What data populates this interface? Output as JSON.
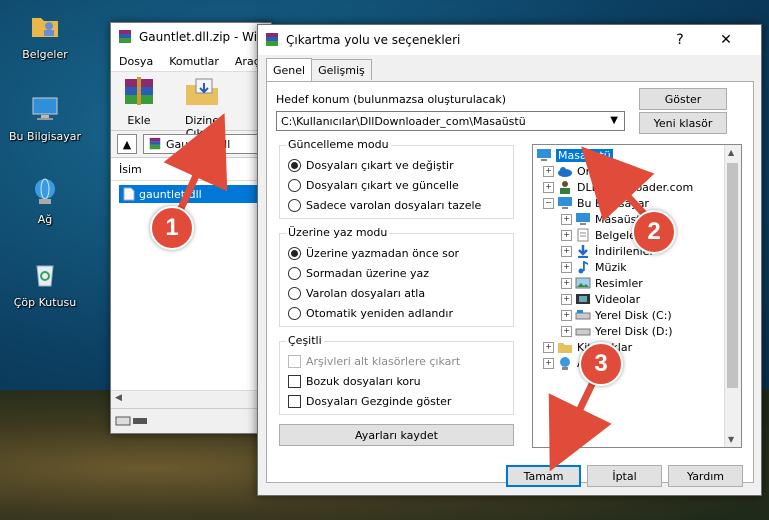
{
  "desktop": {
    "icons": [
      {
        "label": "Belgeler"
      },
      {
        "label": "Bu Bilgisayar"
      },
      {
        "label": "Ağ"
      },
      {
        "label": "Çöp Kutusu"
      }
    ]
  },
  "winrar": {
    "title": "Gauntlet.dll.zip - Win",
    "menu": [
      "Dosya",
      "Komutlar",
      "Araçla"
    ],
    "toolbar": {
      "extract_label": "Ekle",
      "extract_to_label": "Dizine Çıkart"
    },
    "path": "Gauntlet.dll",
    "column_name": "İsim",
    "file_name": "gauntlet.dll"
  },
  "dialog": {
    "title": "Çıkartma yolu ve seçenekleri",
    "help": "?",
    "close": "✕",
    "tabs": [
      "Genel",
      "Gelişmiş"
    ],
    "dest_label": "Hedef konum (bulunmazsa oluşturulacak)",
    "dest_value": "C:\\Kullanıcılar\\DllDownloader_com\\Masaüstü",
    "show_button": "Göster",
    "new_folder_button": "Yeni klasör",
    "update_mode": {
      "title": "Güncelleme modu",
      "options": [
        "Dosyaları çıkart ve değiştir",
        "Dosyaları çıkart ve güncelle",
        "Sadece varolan dosyaları tazele"
      ],
      "selected": 0
    },
    "overwrite_mode": {
      "title": "Üzerine yaz modu",
      "options": [
        "Üzerine yazmadan önce sor",
        "Sormadan üzerine yaz",
        "Varolan dosyaları atla",
        "Otomatik yeniden adlandır"
      ],
      "selected": 0
    },
    "misc": {
      "title": "Çeşitli",
      "options": [
        "Arşivleri alt klasörlere çıkart",
        "Bozuk dosyaları koru",
        "Dosyaları Gezginde göster"
      ],
      "disabled": [
        true,
        false,
        false
      ]
    },
    "save_settings": "Ayarları kaydet",
    "tree": [
      {
        "label": "Masaüstü",
        "icon": "desktop-icon",
        "selected": true
      },
      {
        "label": "OneDrive",
        "icon": "cloud-icon",
        "exp": "+"
      },
      {
        "label": "DLL Downloader.com",
        "icon": "user-icon",
        "exp": "+"
      },
      {
        "label": "Bu Bilgisayar",
        "icon": "computer-icon",
        "exp": "−"
      },
      {
        "label": "Masaüstü",
        "icon": "desktop-icon",
        "exp": "+"
      },
      {
        "label": "Belgeler",
        "icon": "documents-icon",
        "exp": "+"
      },
      {
        "label": "İndirilenler",
        "icon": "download-icon",
        "exp": "+"
      },
      {
        "label": "Müzik",
        "icon": "music-icon",
        "exp": "+"
      },
      {
        "label": "Resimler",
        "icon": "pictures-icon",
        "exp": "+"
      },
      {
        "label": "Videolar",
        "icon": "video-icon",
        "exp": "+"
      },
      {
        "label": "Yerel Disk (C:)",
        "icon": "drive-icon",
        "exp": "+"
      },
      {
        "label": "Yerel Disk (D:)",
        "icon": "drive-icon",
        "exp": "+"
      },
      {
        "label": "Kitaplıklar",
        "icon": "folder-icon",
        "exp": "+"
      },
      {
        "label": "Ağ",
        "icon": "network-icon",
        "exp": "+"
      }
    ],
    "ok_button": "Tamam",
    "cancel_button": "İptal",
    "help_button": "Yardım"
  },
  "annotations": [
    "1",
    "2",
    "3"
  ],
  "colors": {
    "accent": "#0078d7",
    "annotation": "#e14b3a"
  }
}
